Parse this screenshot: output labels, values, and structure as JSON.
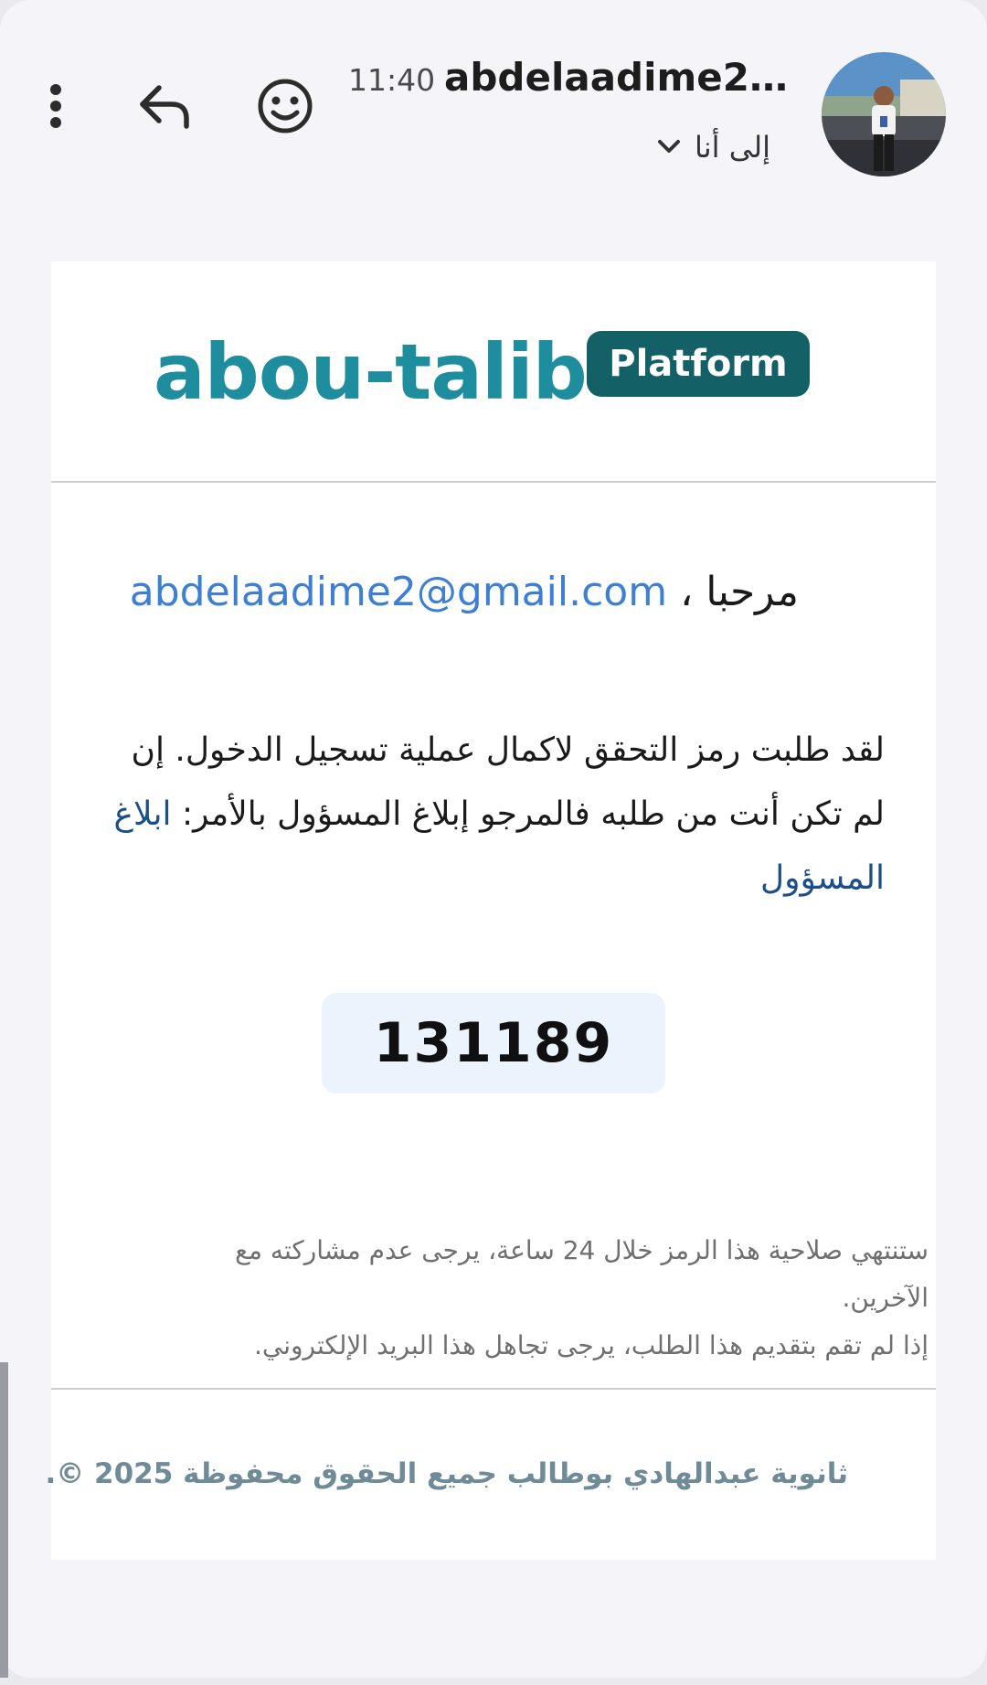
{
  "header": {
    "time": "11:40",
    "sender": "abdelaadime2@...",
    "to_label": "إلى أنا",
    "icons": {
      "more": "more-vert-icon",
      "reply": "reply-icon",
      "emoji": "emoji-icon",
      "expand": "chevron-down-icon"
    }
  },
  "email": {
    "logo": {
      "wordmark": "abou-talib",
      "pill": "Platform",
      "colors": {
        "wordmark": "#1e8d9d",
        "pill": "#146067"
      }
    },
    "greeting": {
      "word": "مرحبا",
      "email": "abdelaadime2@gmail.com"
    },
    "body": {
      "text": "لقد طلبت رمز التحقق لاكمال عملية تسجيل الدخول. إن لم تكن أنت من طلبه فالمرجو إبلاغ المسؤول بالأمر:",
      "link": "ابلاغ المسؤول"
    },
    "code": "131189",
    "notice": {
      "line1": "ستنتهي صلاحية هذا الرمز خلال 24 ساعة، يرجى عدم مشاركته مع الآخرين.",
      "line2": "إذا لم تقم بتقديم هذا الطلب، يرجى تجاهل هذا البريد الإلكتروني."
    },
    "footer": "ثانوية عبدالهادي بوطالب جميع الحقوق محفوظة 2025 ©."
  }
}
